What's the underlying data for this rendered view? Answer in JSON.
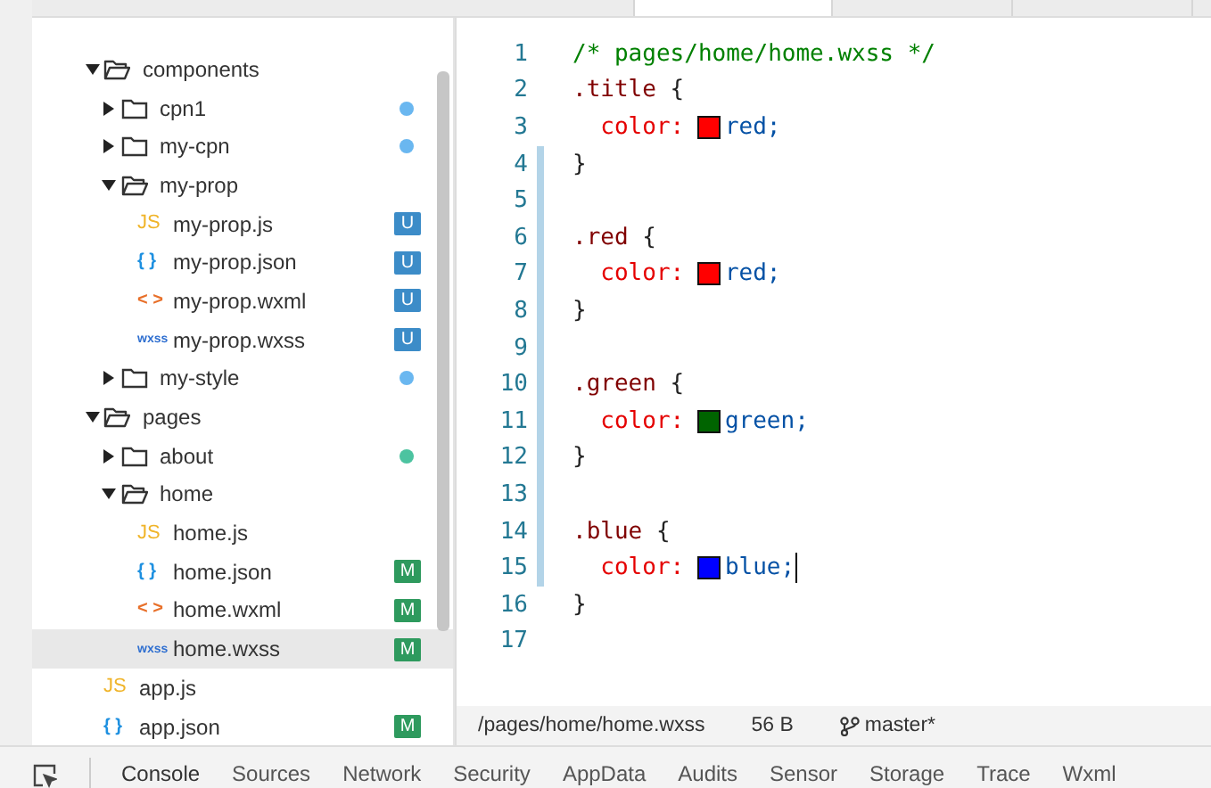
{
  "tree": [
    {
      "name": "components",
      "kind": "folder",
      "expanded": true,
      "selected": false,
      "children": [
        {
          "name": "cpn1",
          "kind": "folder",
          "expanded": false,
          "selected": false,
          "color": "#6ab7f0"
        },
        {
          "name": "my-cpn",
          "kind": "folder",
          "expanded": false,
          "selected": false,
          "color": "#6ab7f0"
        },
        {
          "name": "my-prop",
          "kind": "folder",
          "expanded": true,
          "selected": false,
          "children": [
            {
              "name": "my-prop.js",
              "kind": "js",
              "icon_text": "JS",
              "selected": false,
              "badge": "U"
            },
            {
              "name": "my-prop.json",
              "kind": "json",
              "icon_text": "{ }",
              "selected": false,
              "badge": "U"
            },
            {
              "name": "my-prop.wxml",
              "kind": "wxml",
              "icon_text": "< >",
              "selected": false,
              "badge": "U"
            },
            {
              "name": "my-prop.wxss",
              "kind": "wxss",
              "icon_text": "wxss",
              "selected": false,
              "badge": "U"
            }
          ]
        },
        {
          "name": "my-style",
          "kind": "folder",
          "expanded": false,
          "selected": false,
          "color": "#6ab7f0"
        }
      ]
    },
    {
      "name": "pages",
      "kind": "folder",
      "expanded": true,
      "selected": false,
      "children": [
        {
          "name": "about",
          "kind": "folder",
          "expanded": false,
          "selected": false,
          "color": "#4cc3a0"
        },
        {
          "name": "home",
          "kind": "folder",
          "expanded": true,
          "selected": false,
          "children": [
            {
              "name": "home.js",
              "kind": "js",
              "icon_text": "JS",
              "selected": false
            },
            {
              "name": "home.json",
              "kind": "json",
              "icon_text": "{ }",
              "selected": false,
              "badge": "M"
            },
            {
              "name": "home.wxml",
              "kind": "wxml",
              "icon_text": "< >",
              "selected": false,
              "badge": "M"
            },
            {
              "name": "home.wxss",
              "kind": "wxss",
              "icon_text": "wxss",
              "selected": true,
              "badge": "M"
            }
          ]
        }
      ]
    },
    {
      "name": "app.js",
      "kind": "js",
      "icon_text": "JS",
      "selected": false
    },
    {
      "name": "app.json",
      "kind": "json",
      "icon_text": "{ }",
      "selected": false,
      "badge": "M"
    }
  ],
  "editor": {
    "tabs": [
      {
        "selected": false
      },
      {
        "selected": true
      },
      {
        "selected": false
      },
      {
        "selected": false
      }
    ],
    "lines": [
      {
        "number": "1",
        "modified": false,
        "tokens": [
          {
            "kind": "comment",
            "text": "/* pages/home/home.wxss */"
          }
        ]
      },
      {
        "number": "2",
        "modified": false,
        "tokens": [
          {
            "kind": "selector",
            "text": ".title"
          },
          {
            "kind": "brace",
            "text": " {"
          }
        ]
      },
      {
        "number": "3",
        "modified": false,
        "tokens": [
          {
            "kind": "prop",
            "text": "  color: "
          },
          {
            "kind": "swatch",
            "color": "#ff0000"
          },
          {
            "kind": "value",
            "text": "red;"
          }
        ]
      },
      {
        "number": "4",
        "modified": true,
        "tokens": [
          {
            "kind": "brace",
            "text": "}"
          }
        ]
      },
      {
        "number": "5",
        "modified": true
      },
      {
        "number": "6",
        "modified": true,
        "tokens": [
          {
            "kind": "selector",
            "text": ".red"
          },
          {
            "kind": "brace",
            "text": " {"
          }
        ]
      },
      {
        "number": "7",
        "modified": true,
        "tokens": [
          {
            "kind": "prop",
            "text": "  color: "
          },
          {
            "kind": "swatch",
            "color": "#ff0000"
          },
          {
            "kind": "value",
            "text": "red;"
          }
        ]
      },
      {
        "number": "8",
        "modified": true,
        "tokens": [
          {
            "kind": "brace",
            "text": "}"
          }
        ]
      },
      {
        "number": "9",
        "modified": true
      },
      {
        "number": "10",
        "modified": true,
        "tokens": [
          {
            "kind": "selector",
            "text": ".green"
          },
          {
            "kind": "brace",
            "text": " {"
          }
        ]
      },
      {
        "number": "11",
        "modified": true,
        "tokens": [
          {
            "kind": "prop",
            "text": "  color: "
          },
          {
            "kind": "swatch",
            "color": "#006400"
          },
          {
            "kind": "value",
            "text": "green;"
          }
        ]
      },
      {
        "number": "12",
        "modified": true,
        "tokens": [
          {
            "kind": "brace",
            "text": "}"
          }
        ]
      },
      {
        "number": "13",
        "modified": true
      },
      {
        "number": "14",
        "modified": true,
        "tokens": [
          {
            "kind": "selector",
            "text": ".blue"
          },
          {
            "kind": "brace",
            "text": " {"
          }
        ]
      },
      {
        "number": "15",
        "modified": true,
        "caret": true,
        "tokens": [
          {
            "kind": "prop",
            "text": "  color: "
          },
          {
            "kind": "swatch",
            "color": "#0000ff"
          },
          {
            "kind": "value",
            "text": "blue;"
          }
        ]
      },
      {
        "number": "16",
        "modified": false,
        "tokens": [
          {
            "kind": "brace",
            "text": "}"
          }
        ]
      },
      {
        "number": "17",
        "modified": false
      }
    ]
  },
  "status_bar": {
    "path": "/pages/home/home.wxss",
    "size": "56 B",
    "branch": "master*"
  },
  "devtools_tabs": [
    {
      "label": "Console",
      "selected": true
    },
    {
      "label": "Sources",
      "selected": false
    },
    {
      "label": "Network",
      "selected": false
    },
    {
      "label": "Security",
      "selected": false
    },
    {
      "label": "AppData",
      "selected": false
    },
    {
      "label": "Audits",
      "selected": false
    },
    {
      "label": "Sensor",
      "selected": false
    },
    {
      "label": "Storage",
      "selected": false
    },
    {
      "label": "Trace",
      "selected": false
    },
    {
      "label": "Wxml",
      "selected": false
    }
  ]
}
